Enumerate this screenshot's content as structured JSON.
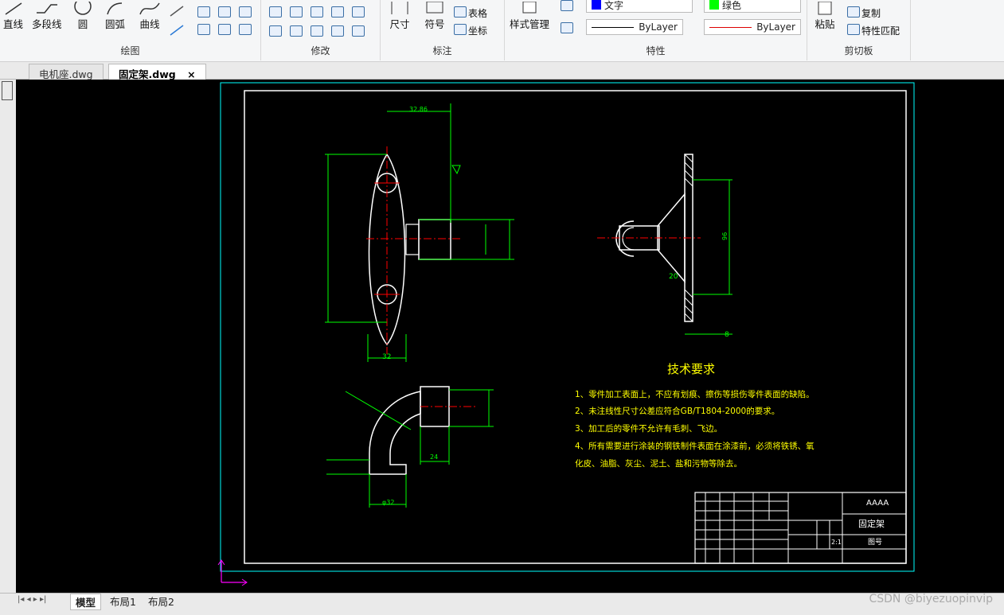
{
  "ribbon": {
    "draw": {
      "line": "直线",
      "polyline": "多段线",
      "circle": "圆",
      "arc": "圆弧",
      "curve": "曲线",
      "group": "绘图"
    },
    "modify": {
      "group": "修改"
    },
    "annot": {
      "dimension": "尺寸",
      "symbol": "符号",
      "table": "表格",
      "coord": "坐标",
      "group": "标注"
    },
    "props": {
      "style_mgr": "样式管理",
      "text": "文字",
      "color": "绿色",
      "bylayer1": "ByLayer",
      "bylayer2": "ByLayer",
      "group": "特性"
    },
    "clipboard": {
      "paste": "粘贴",
      "copy": "复制",
      "match": "特性匹配",
      "group": "剪切板"
    }
  },
  "tabs": [
    {
      "label": "电机座.dwg"
    },
    {
      "label": "固定架.dwg",
      "close": "×"
    }
  ],
  "layouts": {
    "model": "模型",
    "layout1": "布局1",
    "layout2": "布局2"
  },
  "drawing": {
    "tech_title": "技术要求",
    "req1": "1、零件加工表面上，不应有划痕、擦伤等损伤零件表面的缺陷。",
    "req2": "2、未注线性尺寸公差应符合GB/T1804-2000的要求。",
    "req3": "3、加工后的零件不允许有毛刺、飞边。",
    "req4a": "4、所有需要进行涂装的钢铁制件表面在涂漆前，必须将铁锈、氧",
    "req4b": "化皮、油脂、灰尘、泥土、盐和污物等除去。",
    "part_name": "固定架",
    "company": "AAAA",
    "drawing_no": "图号",
    "scale": "2:1",
    "dim_top": "32.86",
    "dim_width": "32",
    "dim_20": "20",
    "dim_8": "8",
    "dim_24": "24",
    "dim_r": "φ32",
    "dim_96": "96"
  },
  "colors": {
    "canvas": "#000000",
    "green": "#00ff00",
    "yellow": "#ffff00",
    "cyan": "#00ffff",
    "red": "#ff0000",
    "white": "#ffffff"
  },
  "watermark": "CSDN @biyezuopinvip"
}
